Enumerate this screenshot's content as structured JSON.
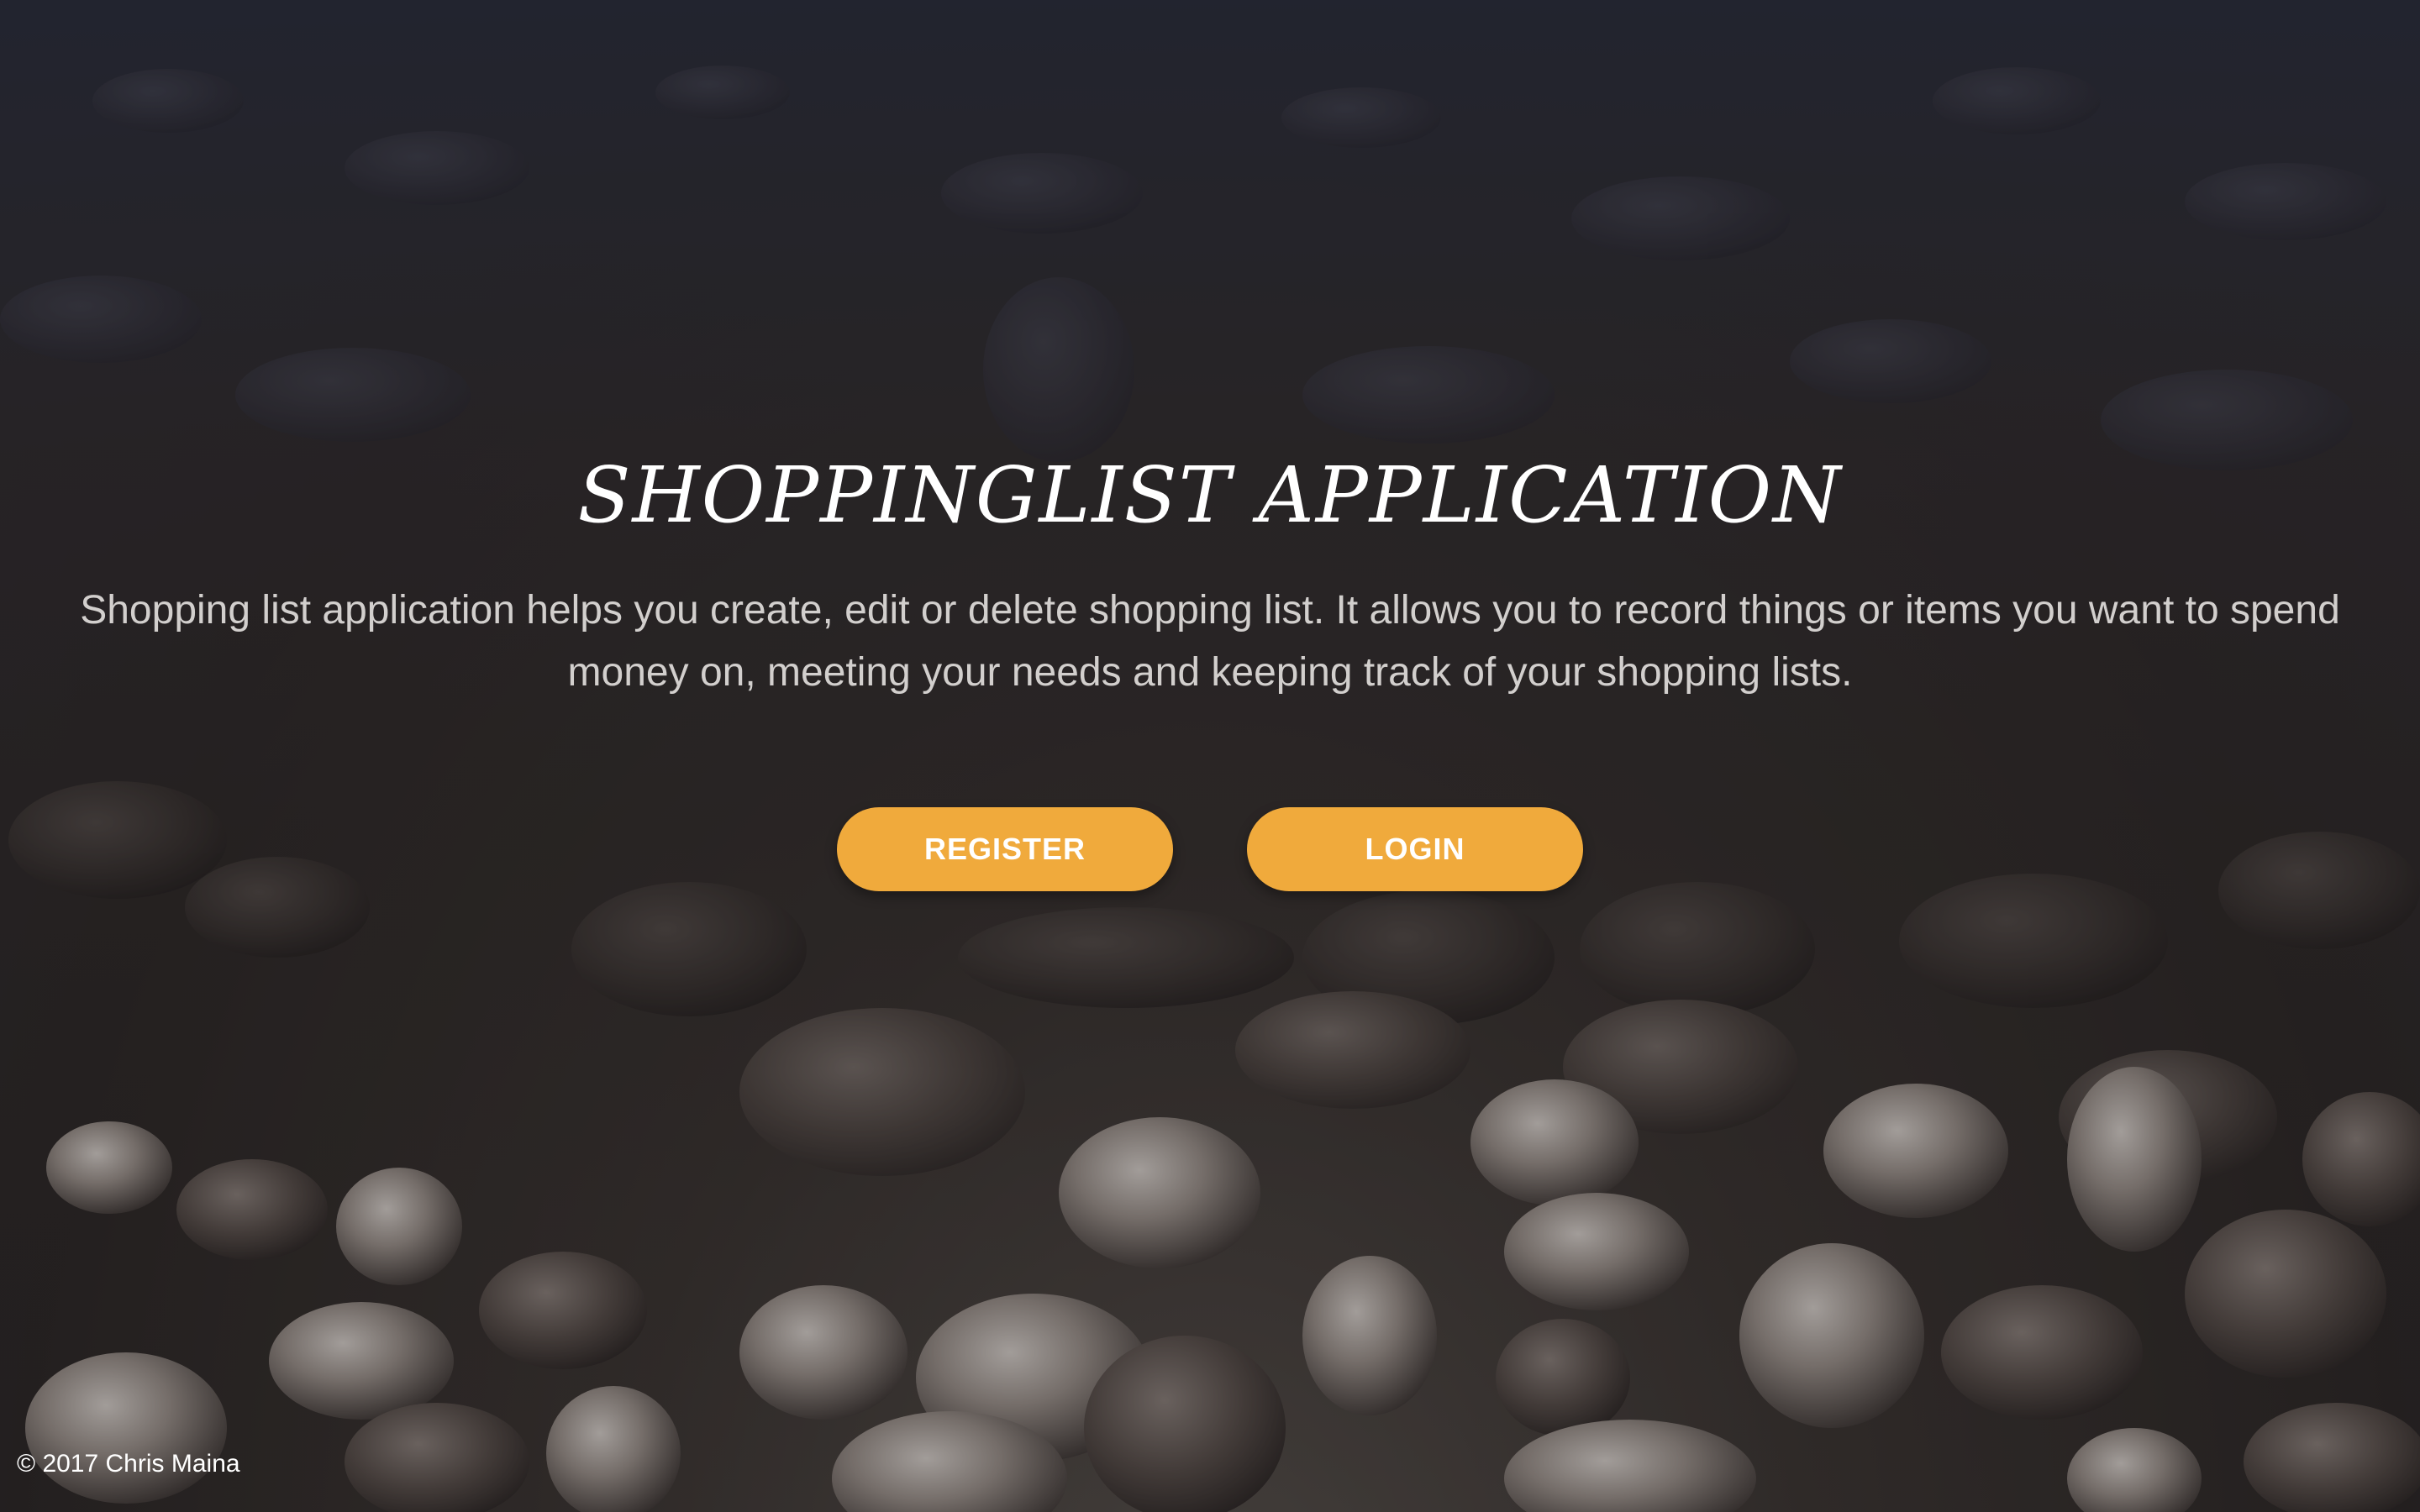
{
  "hero": {
    "title": "SHOPPINGLIST APPLICATION",
    "description": "Shopping list application helps you create, edit or delete shopping list. It allows you to record things or items you want to spend money on, meeting your needs and keeping track of your shopping lists."
  },
  "actions": {
    "register_label": "REGISTER",
    "login_label": "LOGIN"
  },
  "footer": {
    "copyright": "© 2017 Chris Maina"
  },
  "colors": {
    "button": "#f0aa3c",
    "title": "#ffffff",
    "description": "#d2cfcd"
  }
}
